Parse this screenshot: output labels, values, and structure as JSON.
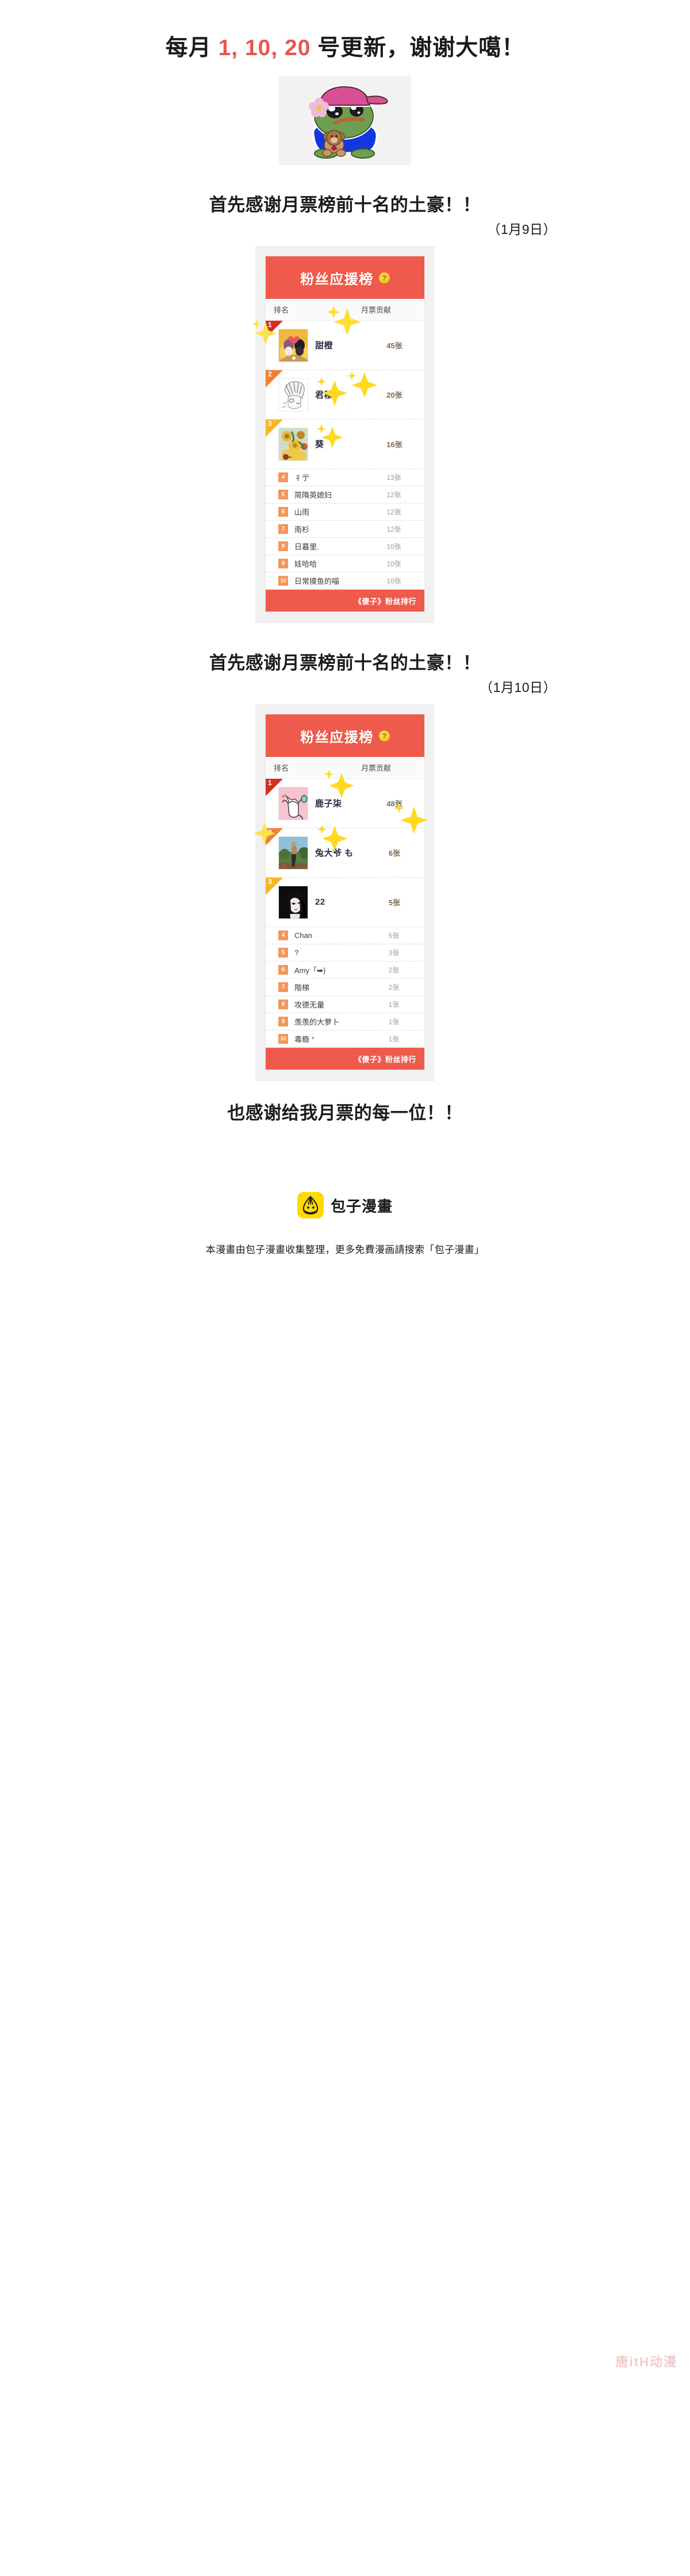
{
  "headline": {
    "prefix": "每月 ",
    "days": "1, 10, 20",
    "suffix": " 号更新，谢谢大噶！",
    "accent_color": "#e8574a"
  },
  "sticker": {
    "name": "pepe-frog-with-teddy-bear",
    "hat_color": "#d94f95",
    "body_color": "#6e9e4f",
    "shirt_color": "#1338e0",
    "flower_color": "#f0b9d8",
    "bear_color": "#a87545"
  },
  "sections": [
    {
      "heading_line1": "首先感谢月票榜前十名的土豪！！",
      "heading_line2": "（1月9日）",
      "card": {
        "title": "粉丝应援榜",
        "help_icon": "?",
        "col_rank": "排名",
        "col_votes": "月票贡献",
        "footer": "《傻子》粉丝排行",
        "header_color": "#ee5a4b",
        "rows": [
          {
            "rank": "1",
            "name": "甜橙",
            "votes": "45张",
            "avatar": "couple-hearts-gold"
          },
          {
            "rank": "2",
            "name": "君穆.",
            "votes": "20张",
            "avatar": "sketch-boy-bw"
          },
          {
            "rank": "3",
            "name": "葵",
            "votes": "16张",
            "avatar": "sunflowers-painting"
          },
          {
            "rank": "4",
            "name": "彳亍",
            "votes": "13张"
          },
          {
            "rank": "5",
            "name": "简隋英媳妇",
            "votes": "12张"
          },
          {
            "rank": "6",
            "name": "山雨",
            "votes": "12张"
          },
          {
            "rank": "7",
            "name": "南杉",
            "votes": "12张"
          },
          {
            "rank": "8",
            "name": "日暮里.",
            "votes": "10张"
          },
          {
            "rank": "9",
            "name": "娃哈哈",
            "votes": "10张"
          },
          {
            "rank": "10",
            "name": "日常摸鱼的喵",
            "votes": "10张"
          }
        ]
      }
    },
    {
      "heading_line1": "首先感谢月票榜前十名的土豪！！",
      "heading_line2": "（1月10日）",
      "card": {
        "title": "粉丝应援榜",
        "help_icon": "?",
        "col_rank": "排名",
        "col_votes": "月票贡献",
        "footer": "《傻子》粉丝排行",
        "header_color": "#ee5a4b",
        "rows": [
          {
            "rank": "1",
            "name": "鹿子柒",
            "votes": "48张",
            "avatar": "white-cat-pink-bg"
          },
          {
            "rank": "2",
            "name": "兔大爷 も",
            "votes": "6张",
            "avatar": "person-garden-photo"
          },
          {
            "rank": "3",
            "name": "22",
            "votes": "5张",
            "avatar": "manga-girl-dark"
          },
          {
            "rank": "4",
            "name": "Chan",
            "votes": "5张"
          },
          {
            "rank": "5",
            "name": "?",
            "votes": "3张"
          },
          {
            "rank": "6",
            "name": "Amy「➡)",
            "votes": "2张"
          },
          {
            "rank": "7",
            "name": "階梯",
            "votes": "2张"
          },
          {
            "rank": "8",
            "name": "攻德无量",
            "votes": "1张"
          },
          {
            "rank": "9",
            "name": "羡羡的大萝卜",
            "votes": "1张"
          },
          {
            "rank": "10",
            "name": "毒瘾 °",
            "votes": "1张"
          }
        ]
      }
    }
  ],
  "closing": "也感谢给我月票的每一位！！",
  "watermark": "唐itH动漫",
  "brand": {
    "name": "包子漫畫",
    "logo_icon": "steamed-bun-icon",
    "logo_color": "#ffd900"
  },
  "legal": "本漫畫由包子漫畫收集整理，更多免費漫画請搜索「包子漫畫」"
}
